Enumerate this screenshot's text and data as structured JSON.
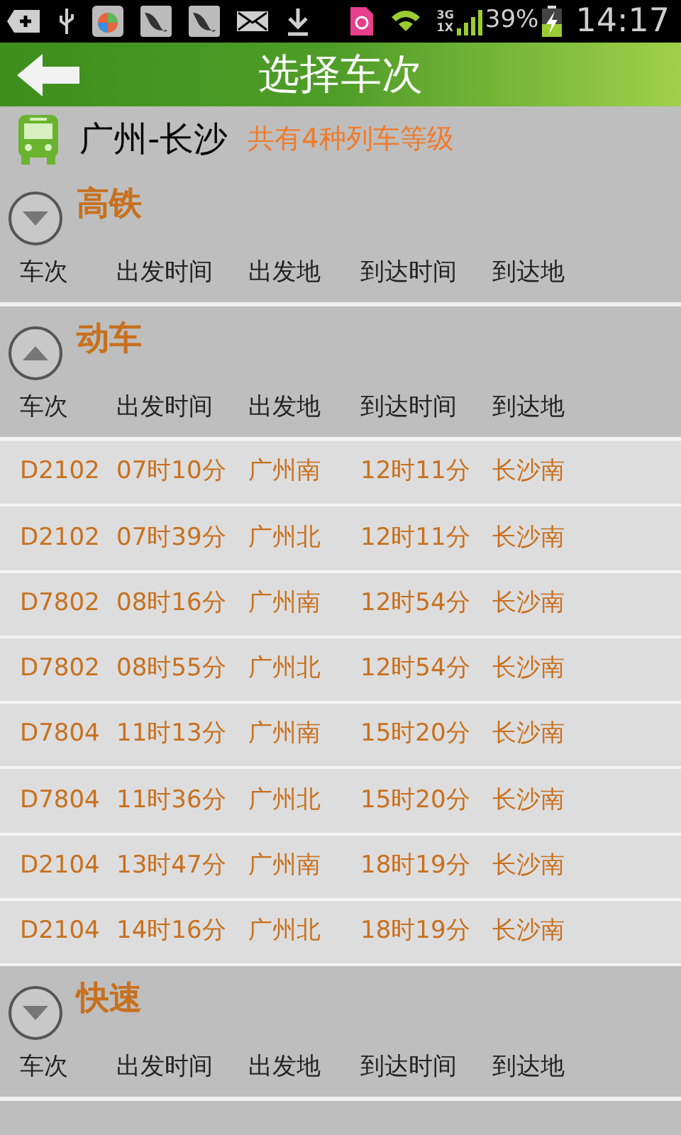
{
  "status_bar": {
    "network_top": "3G",
    "network_bottom": "1X",
    "battery": "39%",
    "time": "14:17"
  },
  "header": {
    "title": "选择车次"
  },
  "route": {
    "name": "广州-长沙",
    "summary": "共有4种列车等级"
  },
  "sections": [
    {
      "title": "高铁",
      "expanded": false,
      "columns": [
        "车次",
        "出发时间",
        "出发地",
        "到达时间",
        "到达地"
      ]
    },
    {
      "title": "动车",
      "expanded": true,
      "columns": [
        "车次",
        "出发时间",
        "出发地",
        "到达时间",
        "到达地"
      ],
      "rows": [
        [
          "D2102",
          "07时10分",
          "广州南",
          "12时11分",
          "长沙南"
        ],
        [
          "D2102",
          "07时39分",
          "广州北",
          "12时11分",
          "长沙南"
        ],
        [
          "D7802",
          "08时16分",
          "广州南",
          "12时54分",
          "长沙南"
        ],
        [
          "D7802",
          "08时55分",
          "广州北",
          "12时54分",
          "长沙南"
        ],
        [
          "D7804",
          "11时13分",
          "广州南",
          "15时20分",
          "长沙南"
        ],
        [
          "D7804",
          "11时36分",
          "广州北",
          "15时20分",
          "长沙南"
        ],
        [
          "D2104",
          "13时47分",
          "广州南",
          "18时19分",
          "长沙南"
        ],
        [
          "D2104",
          "14时16分",
          "广州北",
          "18时19分",
          "长沙南"
        ]
      ]
    },
    {
      "title": "快速",
      "expanded": false,
      "columns": [
        "车次",
        "出发时间",
        "出发地",
        "到达时间",
        "到达地"
      ]
    }
  ]
}
